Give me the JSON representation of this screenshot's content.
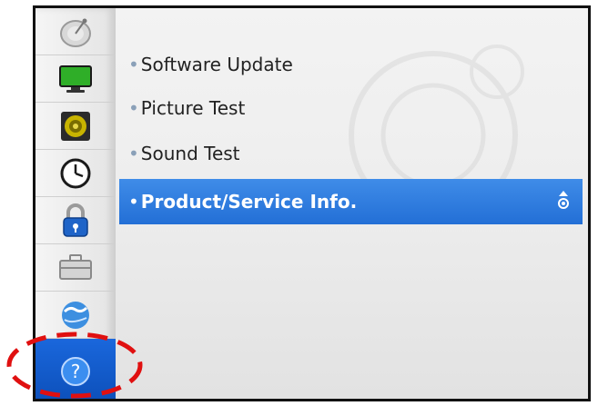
{
  "sidebar": {
    "items": [
      {
        "icon": "satellite-dish-icon",
        "label": "Channel"
      },
      {
        "icon": "monitor-icon",
        "label": "Picture"
      },
      {
        "icon": "speaker-icon",
        "label": "Audio"
      },
      {
        "icon": "clock-icon",
        "label": "Time"
      },
      {
        "icon": "lock-icon",
        "label": "Lock"
      },
      {
        "icon": "toolbox-icon",
        "label": "Option"
      },
      {
        "icon": "network-globe-icon",
        "label": "Network"
      },
      {
        "icon": "help-icon",
        "label": "Support",
        "glyph": "?",
        "active": true
      }
    ]
  },
  "menu": {
    "bullet": "•",
    "items": [
      {
        "label": "Software Update"
      },
      {
        "label": "Picture Test"
      },
      {
        "label": "Sound Test"
      },
      {
        "label": "Product/Service Info.",
        "selected": true
      }
    ]
  },
  "colors": {
    "selection": "#2f7de0",
    "active_sidebar": "#1259c8",
    "highlight_ring": "#e01010"
  }
}
